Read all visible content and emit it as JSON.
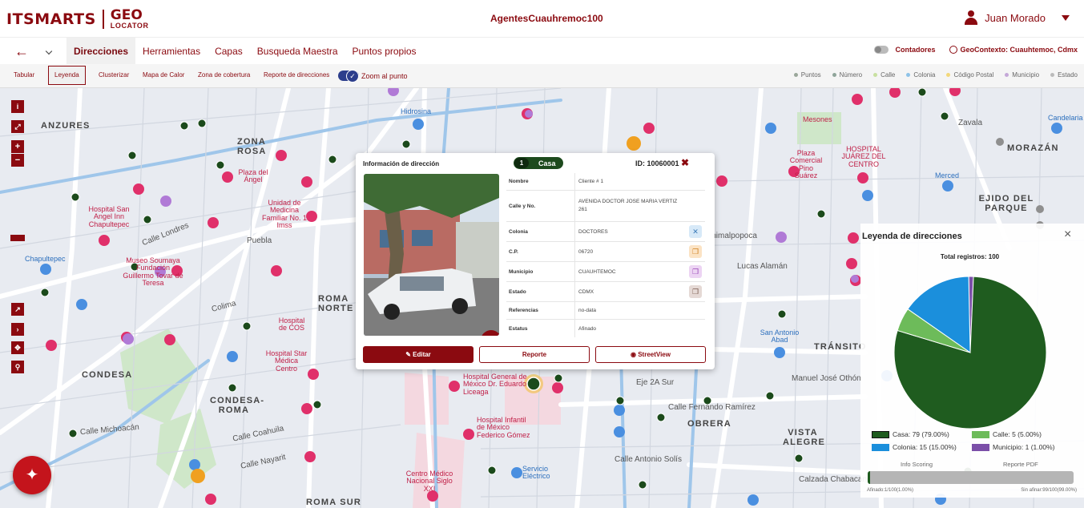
{
  "header": {
    "logo_its": "ITSMARTS",
    "logo_geo_1": "GEO",
    "logo_geo_2": "LOCATOR",
    "app_title": "AgentesCuauhremoc100",
    "user_name": "Juan Morado"
  },
  "nav": {
    "tabs": [
      {
        "label": "Direcciones"
      },
      {
        "label": "Herramientas"
      },
      {
        "label": "Capas"
      },
      {
        "label": "Busqueda Maestra"
      },
      {
        "label": "Puntos propios"
      }
    ],
    "contadores_label": "Contadores",
    "geocontext_label": "GeoContexto: Cuauhtemoc, Cdmx"
  },
  "toolbar": {
    "items": [
      {
        "label": "Tabular"
      },
      {
        "label": "Leyenda"
      },
      {
        "label": "Clusterizar"
      },
      {
        "label": "Mapa de Calor"
      },
      {
        "label": "Zona de cobertura"
      },
      {
        "label": "Reporte de direcciones"
      }
    ],
    "zoom_label": "Zoom al punto",
    "filters": [
      {
        "label": "Puntos",
        "color": "#9aa79a"
      },
      {
        "label": "Número",
        "color": "#8fa59a"
      },
      {
        "label": "Calle",
        "color": "#c8e0a0"
      },
      {
        "label": "Colonia",
        "color": "#8ec3e8"
      },
      {
        "label": "Código Postal",
        "color": "#f3d87a"
      },
      {
        "label": "Municipio",
        "color": "#c5a8d8"
      },
      {
        "label": "Estado",
        "color": "#bbbbbb"
      }
    ]
  },
  "map": {
    "labels": [
      {
        "t": "ANZURES",
        "c": "dist"
      },
      {
        "t": "ZONA ROSA",
        "c": "dist"
      },
      {
        "t": "ROMA NORTE",
        "c": "dist"
      },
      {
        "t": "CONDESA",
        "c": "dist"
      },
      {
        "t": "CONDESA-ROMA",
        "c": "dist"
      },
      {
        "t": "ROMA SUR",
        "c": "dist"
      },
      {
        "t": "MORAZÁN",
        "c": "dist"
      },
      {
        "t": "EJIDO DEL PARQUE",
        "c": "dist"
      },
      {
        "t": "TRÁNSITO",
        "c": "dist"
      },
      {
        "t": "OBRERA",
        "c": "dist"
      },
      {
        "t": "VISTA ALEGRE",
        "c": "dist"
      },
      {
        "t": "Calle Londres",
        "c": "street"
      },
      {
        "t": "Puebla",
        "c": "street"
      },
      {
        "t": "Colima",
        "c": "street"
      },
      {
        "t": "Calle Coahuila",
        "c": "street"
      },
      {
        "t": "Calle Nayarit",
        "c": "street"
      },
      {
        "t": "Lucas Alamán",
        "c": "street"
      },
      {
        "t": "Chimalpopoca",
        "c": "street"
      },
      {
        "t": "Calle Antonio Solís",
        "c": "street"
      },
      {
        "t": "Eje 2A Sur",
        "c": "street"
      },
      {
        "t": "Calle Fernando Ramírez",
        "c": "street"
      },
      {
        "t": "Calzada Chabacano",
        "c": "street"
      },
      {
        "t": "Zavala",
        "c": "street"
      },
      {
        "t": "Calle Michoacán",
        "c": "street"
      },
      {
        "t": "Hospital General de México Dr. Eduardo Liceaga",
        "c": "poi"
      },
      {
        "t": "Hospital Infantil de México Federico Gómez",
        "c": "poi"
      },
      {
        "t": "Centro Médico Nacional Siglo XXI",
        "c": "poi"
      },
      {
        "t": "Unidad de Medicina Familiar No. 1 Imss",
        "c": "poi"
      },
      {
        "t": "Hospital San Angel Inn Chapultepec",
        "c": "poi"
      },
      {
        "t": "Hospital Star Médica Centro",
        "c": "poi"
      },
      {
        "t": "HOSPITAL JUÁREZ DEL CENTRO",
        "c": "poi"
      },
      {
        "t": "Hidrosina",
        "c": "blue"
      },
      {
        "t": "Chapultepec",
        "c": "blue"
      },
      {
        "t": "Plaza del Ángel",
        "c": "poi"
      },
      {
        "t": "Museo Soumaya Fundación Guillermo Tovar de Teresa",
        "c": "poi"
      },
      {
        "t": "Hospital de COS",
        "c": "poi"
      },
      {
        "t": "Plaza Comercial Pino Suárez",
        "c": "poi"
      },
      {
        "t": "Mesones",
        "c": "poi"
      },
      {
        "t": "Merced",
        "c": "blue"
      },
      {
        "t": "Candelaria",
        "c": "blue"
      },
      {
        "t": "Servicio Eléctrico",
        "c": "blue"
      },
      {
        "t": "San Antonio Abad",
        "c": "blue"
      },
      {
        "t": "Manuel José Othón",
        "c": "street"
      }
    ]
  },
  "popup": {
    "title": "Información de dirección",
    "badge_number": "1",
    "badge_label": "Casa",
    "id_label": "ID: 10060001",
    "rows": [
      {
        "k": "Nombre",
        "v": "Cliente # 1"
      },
      {
        "k": "Calle y No.",
        "v": "AVENIDA DOCTOR JOSE MARIA VERTIZ 261"
      },
      {
        "k": "Colonia",
        "v": "DOCTORES"
      },
      {
        "k": "C.P.",
        "v": "06720"
      },
      {
        "k": "Municipio",
        "v": "CUAUHTEMOC"
      },
      {
        "k": "Estado",
        "v": "CDMX"
      },
      {
        "k": "Referencias",
        "v": "no-data"
      },
      {
        "k": "Estatus",
        "v": "Afinado"
      }
    ],
    "edit_label": "Editar",
    "report_label": "Reporte",
    "streetview_label": "StreetView"
  },
  "legend": {
    "title": "Leyenda de direcciones",
    "total": "Total registros: 100",
    "keys": [
      {
        "label": "Casa: 79 (79.00%)",
        "color": "#1f5c1f"
      },
      {
        "label": "Calle: 5 (5.00%)",
        "color": "#6dbb5a"
      },
      {
        "label": "Colonia: 15 (15.00%)",
        "color": "#1b8fdc"
      },
      {
        "label": "Municipio: 1 (1.00%)",
        "color": "#7b4fa8"
      }
    ],
    "info_scoring": "Info Scoring",
    "reporte_pdf": "Reporte PDF",
    "afinado": "Afinado:1/100(1.00%)",
    "sin_afinar": "Sin afinar:99/100(99.00%)"
  },
  "chart_data": {
    "type": "pie",
    "title": "Leyenda de direcciones",
    "categories": [
      "Casa",
      "Calle",
      "Colonia",
      "Municipio"
    ],
    "values": [
      79,
      5,
      15,
      1
    ],
    "colors": [
      "#1f5c1f",
      "#6dbb5a",
      "#1b8fdc",
      "#7b4fa8"
    ]
  }
}
